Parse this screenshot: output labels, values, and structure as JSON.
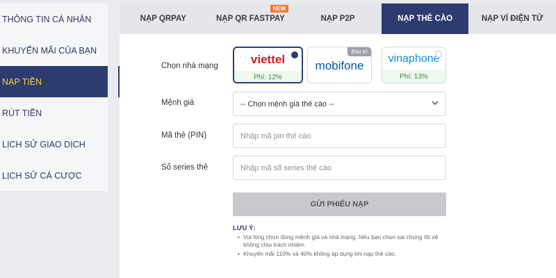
{
  "sidebar": {
    "items": [
      {
        "label": "THÔNG TIN CÁ NHÂN"
      },
      {
        "label": "KHUYẾN MÃI CỦA BẠN"
      },
      {
        "label": "NẠP TIỀN"
      },
      {
        "label": "RÚT TIỀN"
      },
      {
        "label": "LỊCH SỬ GIAO DỊCH"
      },
      {
        "label": "LỊCH SỬ CÁ CƯỢC"
      }
    ],
    "active_index": 2
  },
  "tabs": [
    {
      "label": "NẠP QRPAY"
    },
    {
      "label": "NẠP QR FASTPAY",
      "badge": "NEW"
    },
    {
      "label": "NẠP P2P"
    },
    {
      "label": "NẠP THẺ CÀO"
    },
    {
      "label": "NẠP VÍ ĐIỆN TỬ"
    }
  ],
  "active_tab": 3,
  "form": {
    "carrier_label": "Chọn nhà mạng",
    "carriers": [
      {
        "name": "viettel",
        "fee": "Phí: 12%",
        "color": "#d71a21",
        "selected": true
      },
      {
        "name": "mobifone",
        "fee": "",
        "color": "#0056a4",
        "maintenance": "Bảo trì"
      },
      {
        "name": "vinaphone",
        "fee": "Phí: 13%",
        "color": "#0a8fd8"
      }
    ],
    "denomination_label": "Mệnh giá",
    "denomination_value": "-- Chọn mệnh giá thẻ cào --",
    "pin_label": "Mã thẻ (PIN)",
    "pin_placeholder": "Nhập mã pin thẻ cào",
    "serial_label": "Số series thẻ",
    "serial_placeholder": "Nhập mã số series thẻ cào",
    "submit_label": "GỬI PHIẾU NẠP"
  },
  "notes": {
    "title": "LƯU Ý:",
    "items": [
      "Vui lòng chọn đúng mệnh giá và nhà mạng. Nếu bạn chọn sai chúng tôi sẽ không chịu trách nhiệm.",
      "Khuyến mãi 110% và 40% không áp dụng khi nạp thẻ cào."
    ]
  },
  "icons": {
    "select_arrow": "chevron-down-icon"
  },
  "colors": {
    "primary": "#2d3b6e",
    "active_text": "#f6d33b",
    "badge": "#f2762e"
  }
}
